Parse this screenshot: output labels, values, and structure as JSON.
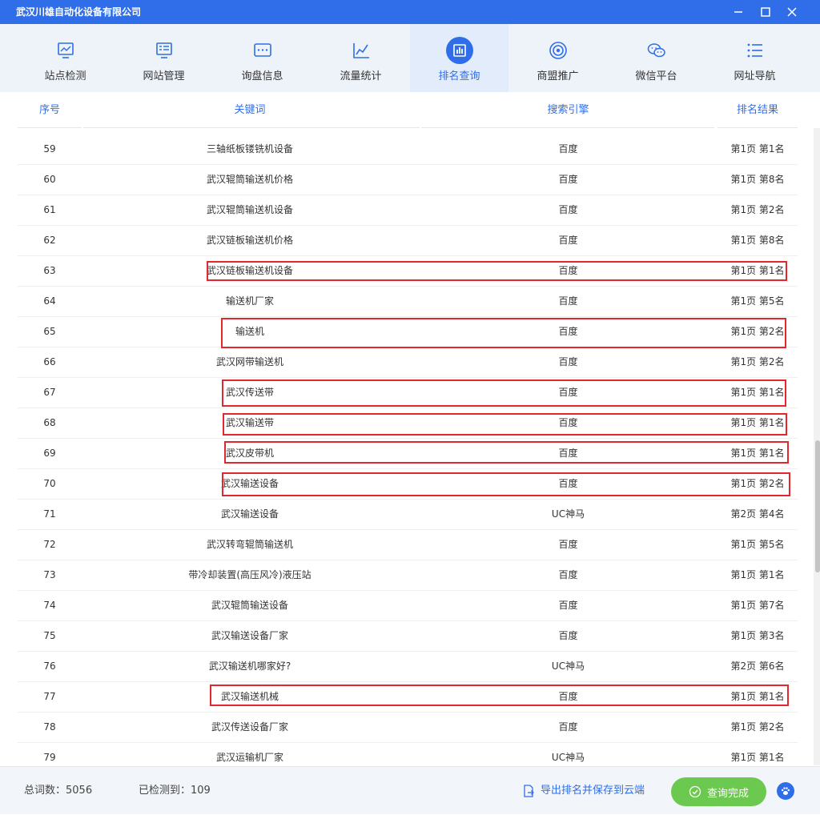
{
  "app": {
    "title": "武汉川雄自动化设备有限公司"
  },
  "colors": {
    "primary": "#2f6ee8",
    "highlight": "#e0282e",
    "success": "#6cc94f"
  },
  "nav": {
    "tabs": [
      {
        "label": "站点检测",
        "icon": "monitor-chart-icon"
      },
      {
        "label": "网站管理",
        "icon": "monitor-list-icon"
      },
      {
        "label": "询盘信息",
        "icon": "message-dots-icon"
      },
      {
        "label": "流量统计",
        "icon": "line-chart-icon"
      },
      {
        "label": "排名查询",
        "icon": "bar-chart-icon",
        "active": true
      },
      {
        "label": "商盟推广",
        "icon": "target-icon"
      },
      {
        "label": "微信平台",
        "icon": "wechat-icon"
      },
      {
        "label": "网址导航",
        "icon": "list-icon"
      }
    ]
  },
  "table": {
    "headers": {
      "index": "序号",
      "keyword": "关键词",
      "engine": "搜索引擎",
      "result": "排名结果"
    },
    "rows": [
      {
        "index": "59",
        "keyword": "三轴纸板镂铣机设备",
        "engine": "百度",
        "result": "第1页 第1名",
        "highlighted": false
      },
      {
        "index": "60",
        "keyword": "武汉辊筒输送机价格",
        "engine": "百度",
        "result": "第1页 第8名",
        "highlighted": false
      },
      {
        "index": "61",
        "keyword": "武汉辊筒输送机设备",
        "engine": "百度",
        "result": "第1页 第2名",
        "highlighted": false
      },
      {
        "index": "62",
        "keyword": "武汉链板输送机价格",
        "engine": "百度",
        "result": "第1页 第8名",
        "highlighted": false
      },
      {
        "index": "63",
        "keyword": "武汉链板输送机设备",
        "engine": "百度",
        "result": "第1页 第1名",
        "highlighted": true
      },
      {
        "index": "64",
        "keyword": "输送机厂家",
        "engine": "百度",
        "result": "第1页 第5名",
        "highlighted": false
      },
      {
        "index": "65",
        "keyword": "输送机",
        "engine": "百度",
        "result": "第1页 第2名",
        "highlighted": true
      },
      {
        "index": "66",
        "keyword": "武汉网带输送机",
        "engine": "百度",
        "result": "第1页 第2名",
        "highlighted": false
      },
      {
        "index": "67",
        "keyword": "武汉传送带",
        "engine": "百度",
        "result": "第1页 第1名",
        "highlighted": true
      },
      {
        "index": "68",
        "keyword": "武汉输送带",
        "engine": "百度",
        "result": "第1页 第1名",
        "highlighted": true
      },
      {
        "index": "69",
        "keyword": "武汉皮带机",
        "engine": "百度",
        "result": "第1页 第1名",
        "highlighted": true
      },
      {
        "index": "70",
        "keyword": "武汉输送设备",
        "engine": "百度",
        "result": "第1页 第2名",
        "highlighted": true
      },
      {
        "index": "71",
        "keyword": "武汉输送设备",
        "engine": "UC神马",
        "result": "第2页 第4名",
        "highlighted": false
      },
      {
        "index": "72",
        "keyword": "武汉转弯辊筒输送机",
        "engine": "百度",
        "result": "第1页 第5名",
        "highlighted": false
      },
      {
        "index": "73",
        "keyword": "带冷却装置(高压风冷)液压站",
        "engine": "百度",
        "result": "第1页 第1名",
        "highlighted": false
      },
      {
        "index": "74",
        "keyword": "武汉辊筒输送设备",
        "engine": "百度",
        "result": "第1页 第7名",
        "highlighted": false
      },
      {
        "index": "75",
        "keyword": "武汉输送设备厂家",
        "engine": "百度",
        "result": "第1页 第3名",
        "highlighted": false
      },
      {
        "index": "76",
        "keyword": "武汉输送机哪家好?",
        "engine": "UC神马",
        "result": "第2页 第6名",
        "highlighted": false
      },
      {
        "index": "77",
        "keyword": "武汉输送机械",
        "engine": "百度",
        "result": "第1页 第1名",
        "highlighted": true
      },
      {
        "index": "78",
        "keyword": "武汉传送设备厂家",
        "engine": "百度",
        "result": "第1页 第2名",
        "highlighted": false
      },
      {
        "index": "79",
        "keyword": "武汉运输机厂家",
        "engine": "UC神马",
        "result": "第1页 第1名",
        "highlighted": false
      }
    ]
  },
  "footer": {
    "total_label": "总词数：5056",
    "checked_label": "已检测到：109",
    "export_label": "导出排名并保存到云端",
    "done_label": "查询完成"
  }
}
